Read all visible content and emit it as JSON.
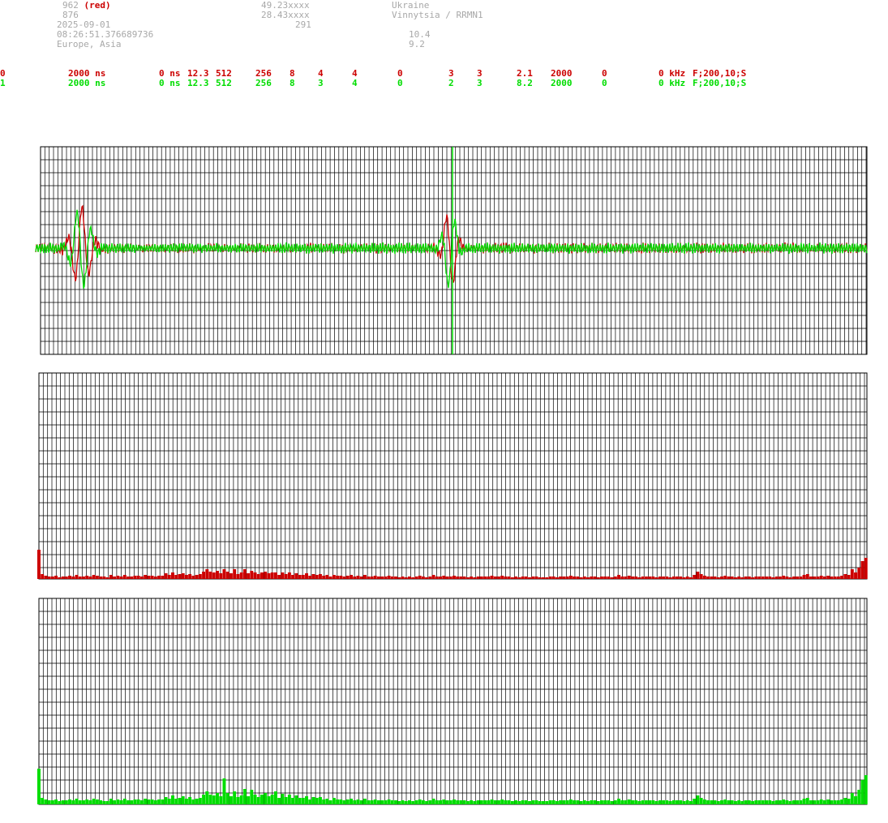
{
  "header": {
    "col1": [
      "962",
      "876",
      "2025-09-01",
      "08:26:51.376689736",
      "Europe, Asia"
    ],
    "col1_red_suffix": "(red)",
    "col2": [
      "49.23xxxx",
      "28.43xxxx",
      "291"
    ],
    "col3": [
      "Ukraine",
      "Vinnytsia / RRMN1"
    ],
    "col4": [
      "10.4",
      "9.2"
    ]
  },
  "channels": [
    {
      "id": "0",
      "period": "2000 ns",
      "offset": "0 ns",
      "v1": "12.3",
      "v2": "512",
      "v3": "256",
      "v4": "8",
      "v5": "4",
      "v6": "4",
      "v7": "0",
      "v8": "3",
      "v9": "3",
      "v10": "2.1",
      "v11": "2000",
      "v12": "0",
      "freq": "0 kHz",
      "filter": "F;200,10;S",
      "color": "#cc0000"
    },
    {
      "id": "1",
      "period": "2000 ns",
      "offset": "0 ns",
      "v1": "12.3",
      "v2": "512",
      "v3": "256",
      "v4": "8",
      "v5": "3",
      "v6": "4",
      "v7": "0",
      "v8": "2",
      "v9": "3",
      "v10": "8.2",
      "v11": "2000",
      "v12": "0",
      "freq": "0 kHz",
      "filter": "F;200,10;S",
      "color": "#00dd00"
    }
  ],
  "colors": {
    "grid": "#000000",
    "red": "#cc0000",
    "green": "#00dd00",
    "label": "#a8a8a8"
  },
  "spectrum_red": [
    36,
    6,
    4,
    3,
    3,
    4,
    2,
    3,
    3,
    4,
    3,
    5,
    3,
    3,
    4,
    3,
    5,
    4,
    3,
    3,
    2,
    5,
    3,
    4,
    3,
    5,
    3,
    3,
    4,
    4,
    3,
    5,
    4,
    4,
    3,
    4,
    4,
    7,
    5,
    8,
    5,
    6,
    7,
    5,
    6,
    4,
    5,
    6,
    9,
    12,
    9,
    8,
    10,
    7,
    12,
    9,
    7,
    12,
    6,
    8,
    12,
    7,
    10,
    8,
    6,
    8,
    9,
    7,
    8,
    8,
    5,
    8,
    6,
    8,
    5,
    7,
    5,
    5,
    7,
    4,
    6,
    5,
    6,
    4,
    5,
    3,
    5,
    4,
    4,
    3,
    4,
    5,
    3,
    4,
    3,
    5,
    3,
    3,
    4,
    3,
    3,
    3,
    4,
    3,
    3,
    2,
    3,
    2,
    3,
    2,
    3,
    4,
    3,
    2,
    3,
    5,
    3,
    3,
    4,
    3,
    3,
    4,
    3,
    3,
    3,
    2,
    3,
    2,
    3,
    3,
    3,
    3,
    4,
    3,
    3,
    4,
    3,
    3,
    2,
    3,
    2,
    3,
    3,
    2,
    3,
    3,
    2,
    2,
    2,
    3,
    3,
    2,
    3,
    3,
    3,
    4,
    3,
    3,
    2,
    3,
    2,
    3,
    3,
    2,
    3,
    3,
    3,
    2,
    3,
    5,
    3,
    3,
    4,
    3,
    3,
    2,
    3,
    3,
    3,
    3,
    2,
    3,
    3,
    3,
    2,
    3,
    3,
    3,
    2,
    3,
    2,
    5,
    9,
    6,
    4,
    3,
    3,
    3,
    2,
    3,
    4,
    3,
    3,
    2,
    3,
    2,
    3,
    3,
    2,
    3,
    3,
    3,
    3,
    3,
    2,
    3,
    3,
    4,
    3,
    2,
    3,
    3,
    3,
    5,
    6,
    3,
    3,
    3,
    4,
    3,
    4,
    3,
    3,
    3,
    4,
    6,
    5,
    12,
    8,
    14,
    22,
    26
  ],
  "spectrum_green": [
    44,
    8,
    6,
    5,
    5,
    6,
    4,
    5,
    5,
    6,
    5,
    7,
    5,
    5,
    6,
    5,
    7,
    6,
    5,
    4,
    4,
    7,
    5,
    6,
    5,
    7,
    5,
    5,
    6,
    6,
    5,
    7,
    6,
    6,
    5,
    6,
    6,
    9,
    7,
    11,
    7,
    8,
    10,
    7,
    9,
    6,
    7,
    8,
    12,
    16,
    12,
    11,
    14,
    10,
    32,
    14,
    10,
    16,
    9,
    11,
    19,
    10,
    18,
    12,
    9,
    12,
    14,
    10,
    12,
    16,
    8,
    13,
    9,
    12,
    8,
    11,
    8,
    8,
    10,
    6,
    9,
    8,
    9,
    6,
    7,
    5,
    8,
    6,
    6,
    5,
    6,
    7,
    5,
    6,
    5,
    7,
    5,
    5,
    6,
    5,
    5,
    5,
    6,
    5,
    5,
    4,
    5,
    4,
    5,
    4,
    5,
    6,
    5,
    4,
    5,
    7,
    5,
    5,
    6,
    5,
    5,
    6,
    5,
    5,
    5,
    4,
    5,
    4,
    5,
    5,
    5,
    5,
    6,
    5,
    5,
    6,
    5,
    5,
    4,
    5,
    4,
    5,
    5,
    4,
    5,
    5,
    4,
    4,
    4,
    5,
    5,
    4,
    5,
    5,
    5,
    6,
    5,
    5,
    4,
    5,
    4,
    5,
    5,
    4,
    5,
    5,
    5,
    4,
    5,
    7,
    5,
    5,
    6,
    5,
    5,
    4,
    5,
    5,
    5,
    5,
    4,
    5,
    5,
    5,
    4,
    5,
    5,
    5,
    4,
    5,
    4,
    7,
    11,
    8,
    6,
    5,
    5,
    5,
    4,
    5,
    6,
    5,
    5,
    4,
    5,
    4,
    5,
    5,
    4,
    5,
    5,
    5,
    5,
    5,
    4,
    5,
    5,
    6,
    5,
    4,
    5,
    5,
    5,
    7,
    8,
    5,
    5,
    5,
    6,
    5,
    6,
    5,
    5,
    5,
    6,
    8,
    7,
    14,
    10,
    18,
    30,
    36
  ]
}
